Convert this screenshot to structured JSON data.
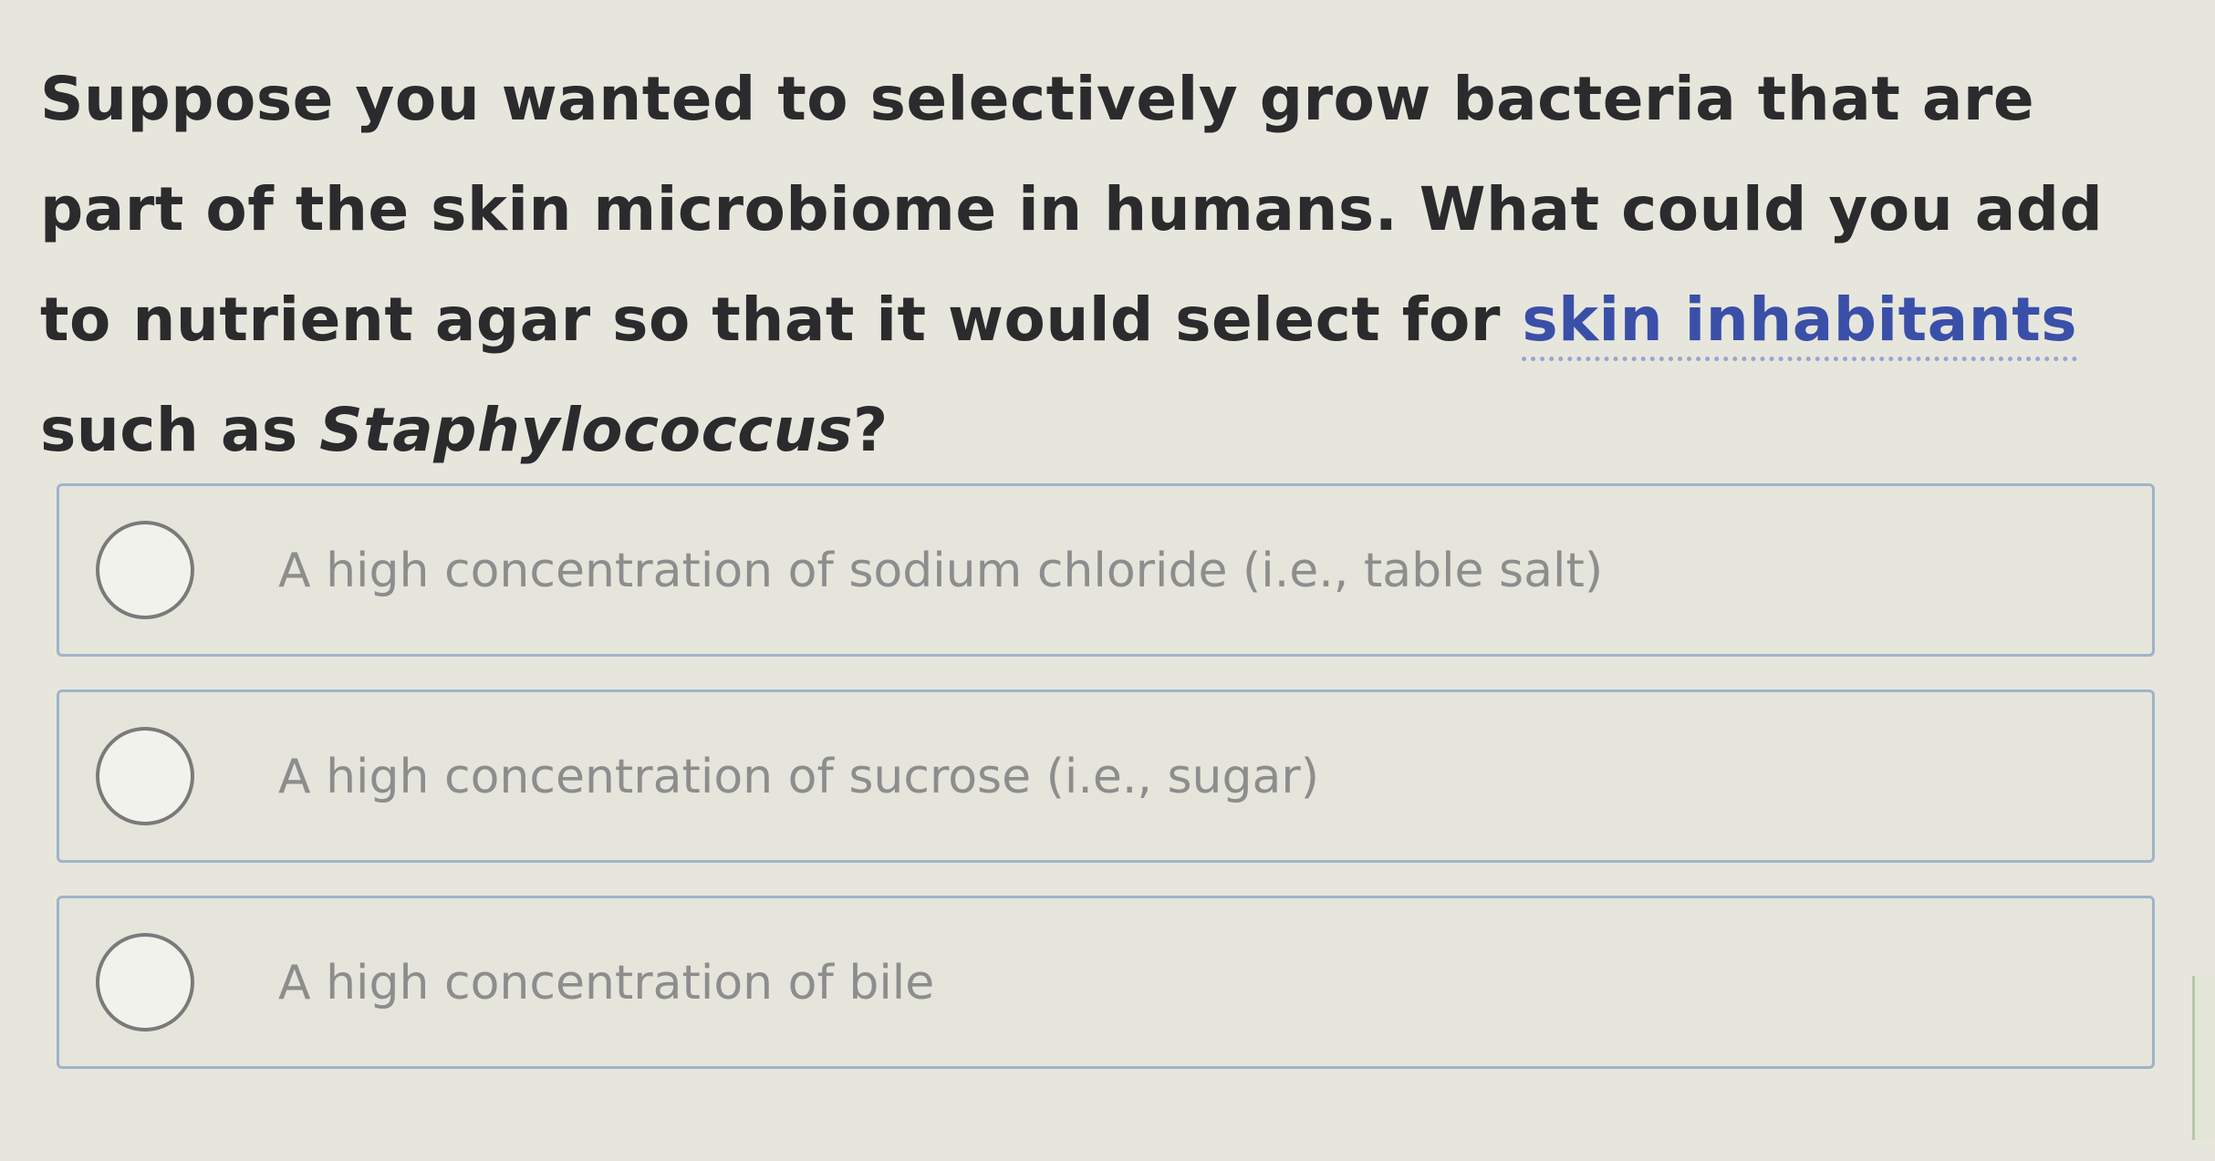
{
  "question": {
    "text_before_term": "Suppose you wanted to selectively grow bacteria that are part of the skin microbiome in humans. What could you add to nutrient agar so that it would select for ",
    "term": "skin inhabitants",
    "text_after_term": " such as ",
    "organism": "Staphylococcus",
    "end_punctuation": "?"
  },
  "options": [
    {
      "label": "A high concentration of sodium chloride (i.e., table salt)",
      "selected": false
    },
    {
      "label": "A high concentration of sucrose (i.e., sugar)",
      "selected": false
    },
    {
      "label": "A high concentration of bile",
      "selected": false
    }
  ],
  "colors": {
    "background": "#e7e6dd",
    "question_text": "#2b2b2d",
    "term_link": "#3a4fa8",
    "option_border": "#9fb4c9",
    "option_text": "#8d8d8d"
  }
}
